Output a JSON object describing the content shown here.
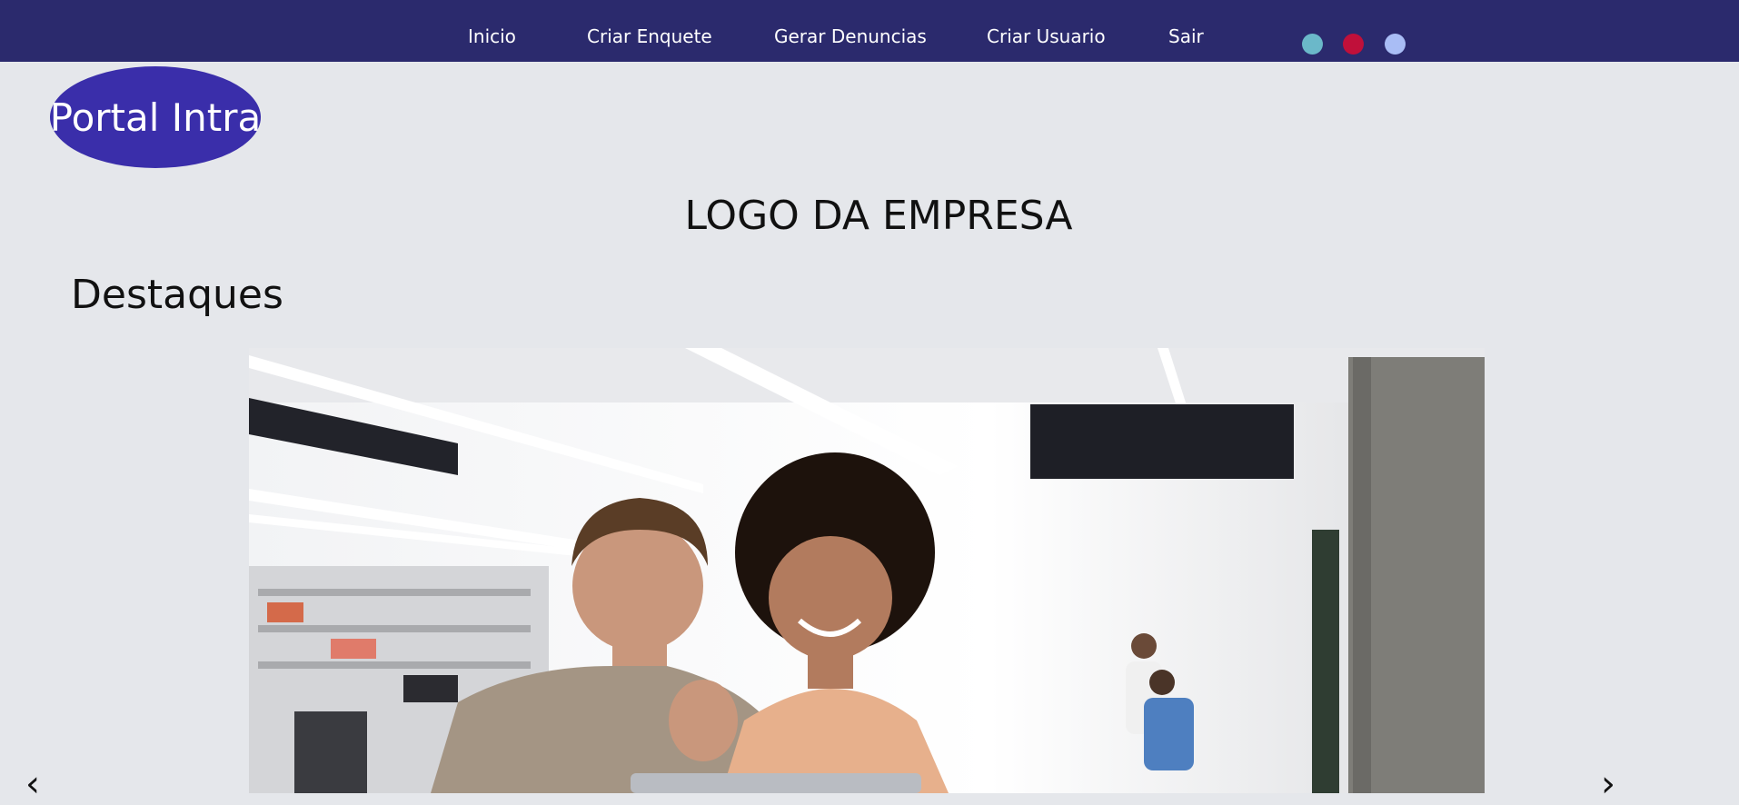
{
  "nav": {
    "items": [
      {
        "label": "Inicio"
      },
      {
        "label": "Criar Enquete"
      },
      {
        "label": "Gerar Denuncias"
      },
      {
        "label": "Criar Usuario"
      },
      {
        "label": "Sair"
      }
    ],
    "theme_dots": [
      {
        "color": "#6bb8c9"
      },
      {
        "color": "#c0103a"
      },
      {
        "color": "#a9bdf5"
      }
    ],
    "background": "#2b2a6d"
  },
  "brand": {
    "title": "Portal Intra",
    "oval_color": "#3a2eaa"
  },
  "header": {
    "company_logo_text": "LOGO DA EMPRESA"
  },
  "highlights": {
    "title": "Destaques",
    "prev_arrow": "‹",
    "next_arrow": "›"
  }
}
